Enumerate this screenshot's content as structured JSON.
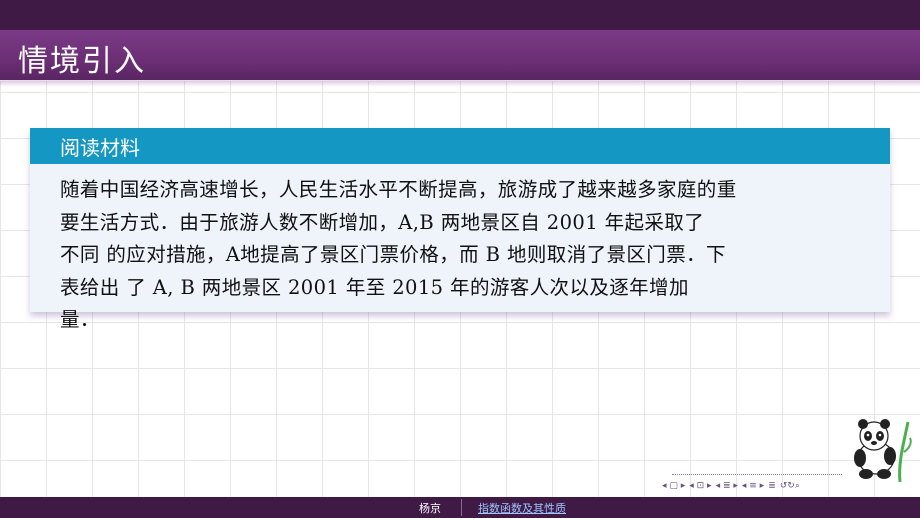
{
  "slide": {
    "title": "情境引入"
  },
  "card": {
    "header": "阅读材料",
    "lines": [
      "随着中国经济高速增长，人民生活水平不断提高，旅游成了越来越多家庭的重",
      "要生活方式．由于旅游人数不断增加，A,B 两地景区自 2001 年起采取了",
      "不同  的应对措施，A地提高了景区门票价格，而 B 地则取消了景区门票．下",
      "表给出  了 A, B 两地景区 2001 年至 2015 年的游客人次以及逐年增加",
      "量．"
    ]
  },
  "nav": {
    "buttons": [
      "◂ ▢ ▸",
      "◂ ⊡ ▸",
      "◂ ≣ ▸",
      "◂ ≡ ▸",
      "≣",
      "↺↻⌕"
    ]
  },
  "footer": {
    "author": "杨京",
    "link": "指数函数及其性质"
  },
  "colors": {
    "title_bar": "#6b2f76",
    "top_bar": "#3e1a45",
    "card_header": "#1597c3",
    "card_body": "#eef4fa"
  }
}
